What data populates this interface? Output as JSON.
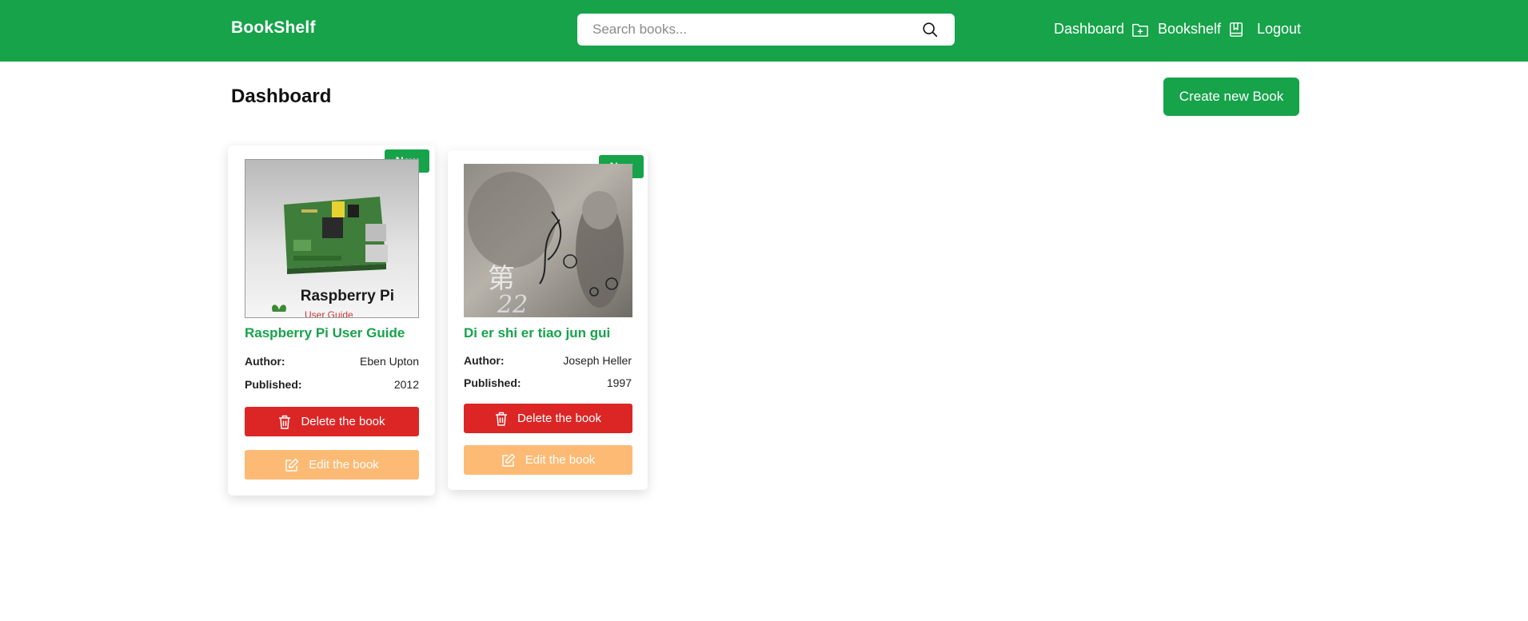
{
  "header": {
    "brand": "BookShelf",
    "search_placeholder": "Search books...",
    "search_icon": "search-icon",
    "nav": [
      {
        "label": "Dashboard",
        "icon": "folder-plus-icon"
      },
      {
        "label": "Bookshelf",
        "icon": "bookmark-book-icon"
      },
      {
        "label": "Logout"
      }
    ]
  },
  "main": {
    "title": "Dashboard",
    "create_button": "Create new Book"
  },
  "books": [
    {
      "badge": "New",
      "title": "Raspberry Pi User Guide",
      "cover_text": "Raspberry Pi",
      "cover_subtext": "User Guide",
      "author_label": "Author:",
      "author": "Eben Upton",
      "published_label": "Published:",
      "published": "2012",
      "delete_label": "Delete the book",
      "edit_label": "Edit the book"
    },
    {
      "badge": "New",
      "title": "Di er shi er tiao jun gui",
      "author_label": "Author:",
      "author": "Joseph Heller",
      "published_label": "Published:",
      "published": "1997",
      "delete_label": "Delete the book",
      "edit_label": "Edit the book"
    }
  ],
  "colors": {
    "primary": "#16a34a",
    "danger": "#dc2626",
    "edit": "#fdba74"
  }
}
